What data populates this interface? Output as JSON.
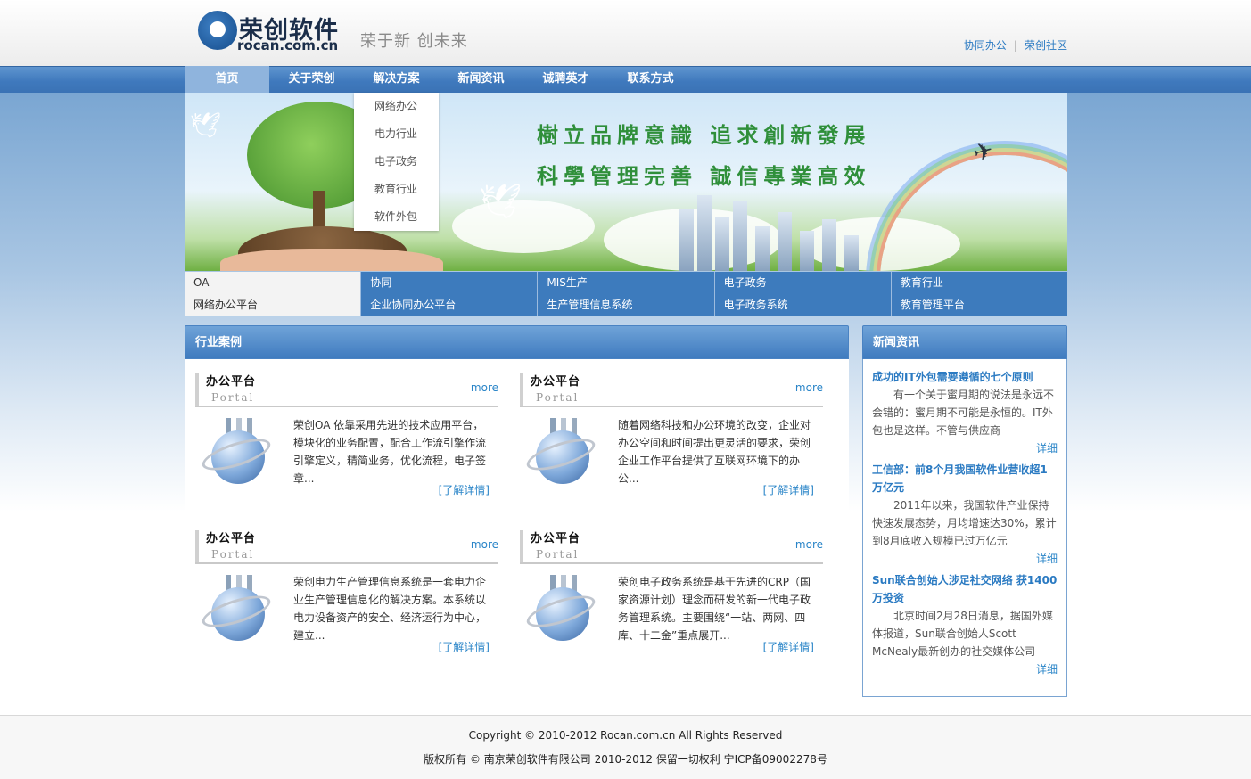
{
  "header": {
    "logo_cn": "荣创软件",
    "logo_en": "rocan.com.cn",
    "slogan": "荣于新  创未来",
    "top_links": [
      "协同办公",
      "荣创社区"
    ],
    "separator": "|"
  },
  "nav": {
    "items": [
      "首页",
      "关于荣创",
      "解决方案",
      "新闻资讯",
      "诚聘英才",
      "联系方式"
    ],
    "active_index": 0
  },
  "dropdown": {
    "items": [
      "网络办公",
      "电力行业",
      "电子政务",
      "教育行业",
      "软件外包"
    ]
  },
  "banner": {
    "line1": "樹立品牌意識  追求創新發展",
    "line2": "科學管理完善  誠信專業高效"
  },
  "product_tabs": [
    {
      "title": "OA",
      "subtitle": "网络办公平台"
    },
    {
      "title": "协同",
      "subtitle": "企业协同办公平台"
    },
    {
      "title": "MIS生产",
      "subtitle": "生产管理信息系统"
    },
    {
      "title": "电子政务",
      "subtitle": "电子政务系统"
    },
    {
      "title": "教育行业",
      "subtitle": "教育管理平台"
    }
  ],
  "cases": {
    "heading": "行业案例",
    "items": [
      {
        "title": "办公平台",
        "sub": "Portal",
        "more": "more",
        "text": "荣创OA 依靠采用先进的技术应用平台，模块化的业务配置，配合工作流引擎作流引擎定义，精简业务，优化流程，电子签章...",
        "link": "[了解详情]"
      },
      {
        "title": "办公平台",
        "sub": "Portal",
        "more": "more",
        "text": "随着网络科技和办公环境的改变，企业对办公空间和时间提出更灵活的要求，荣创企业工作平台提供了互联网环境下的办公...",
        "link": "[了解详情]"
      },
      {
        "title": "办公平台",
        "sub": "Portal",
        "more": "more",
        "text": "荣创电力生产管理信息系统是一套电力企业生产管理信息化的解决方案。本系统以电力设备资产的安全、经济运行为中心，建立...",
        "link": "[了解详情]"
      },
      {
        "title": "办公平台",
        "sub": "Portal",
        "more": "more",
        "text": "荣创电子政务系统是基于先进的CRP（国家资源计划）理念而研发的新一代电子政务管理系统。主要围绕“一站、两网、四库、十二金”重点展开...",
        "link": "[了解详情]"
      }
    ]
  },
  "news": {
    "heading": "新闻资讯",
    "items": [
      {
        "title": "成功的IT外包需要遵循的七个原则",
        "desc": "有一个关于蜜月期的说法是永远不会错的：蜜月期不可能是永恒的。IT外包也是这样。不管与供应商",
        "more": "详细"
      },
      {
        "title": "工信部：前8个月我国软件业营收超1万亿元",
        "desc": "2011年以来，我国软件产业保持快速发展态势，月均增速达30%，累计到8月底收入规模已过万亿元",
        "more": "详细"
      },
      {
        "title": "Sun联合创始人涉足社交网络 获1400万投资",
        "desc": "北京时间2月28日消息，据国外媒体报道，Sun联合创始人Scott McNealy最新创办的社交媒体公司",
        "more": "详细"
      }
    ]
  },
  "footer": {
    "line1": "Copyright © 2010-2012 Rocan.com.cn All Rights Reserved",
    "line2": "版权所有 © 南京荣创软件有限公司 2010-2012 保留一切权利 宁ICP备09002278号"
  },
  "colors": {
    "nav_blue": "#3f79bd",
    "link_blue": "#2a7ac2",
    "panel_blue": "#3f7bbf"
  }
}
